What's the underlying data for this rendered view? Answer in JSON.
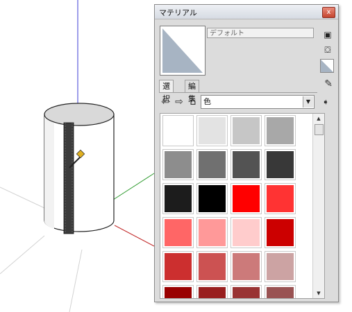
{
  "panel": {
    "title": "マテリアル",
    "close_glyph": "x",
    "material_name": "デフォルト",
    "tabs": [
      "選択",
      "編集"
    ],
    "library": "色",
    "scrollbar_glyphs": {
      "up": "▲",
      "down": "▼"
    }
  },
  "icons": {
    "create": "create-material-icon",
    "bucket": "paint-bucket-icon",
    "default": "default-material-icon",
    "dropper": "eyedropper-icon",
    "back": "back-arrow-icon",
    "forward": "forward-arrow-icon",
    "home": "home-icon",
    "details": "details-arrow-icon"
  },
  "colors": {
    "preview": "#a7b4c3",
    "accent": "#d8503c"
  },
  "swatches": [
    "#ffffff",
    "#e3e3e3",
    "#c6c6c6",
    "#a8a8a8",
    "#8d8d8d",
    "#707070",
    "#535353",
    "#383838",
    "#1c1c1c",
    "#000000",
    "#ff0000",
    "#ff3333",
    "#ff6666",
    "#ff9999",
    "#ffcccc",
    "#cc0000",
    "#cc2f2f",
    "#cc5252",
    "#cc7a7a",
    "#cca3a3",
    "#990000",
    "#991f1f",
    "#993333",
    "#995252"
  ]
}
